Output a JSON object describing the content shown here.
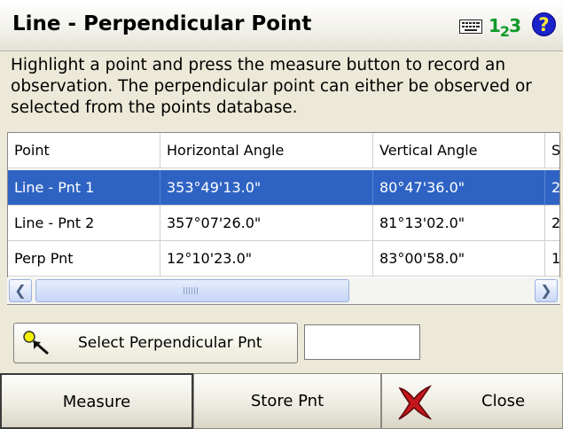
{
  "window": {
    "title": "Line - Perpendicular Point",
    "numeric_indicator": "1",
    "numeric_indicator_sub": "2",
    "numeric_indicator_tail": "3",
    "help_label": "?"
  },
  "instructions": "Highlight a point and press the measure button to record an observation. The perpendicular point can either be observed or selected from the points database.",
  "table": {
    "columns": [
      "Point",
      "Horizontal Angle",
      "Vertical Angle",
      "S"
    ],
    "rows": [
      {
        "point": "Line - Pnt 1",
        "horizontal_angle": "353°49'13.0\"",
        "vertical_angle": "80°47'36.0\"",
        "s": "2",
        "selected": true
      },
      {
        "point": "Line - Pnt 2",
        "horizontal_angle": "357°07'26.0\"",
        "vertical_angle": "81°13'02.0\"",
        "s": "2",
        "selected": false
      },
      {
        "point": "Perp Pnt",
        "horizontal_angle": "12°10'23.0\"",
        "vertical_angle": "83°00'58.0\"",
        "s": "1",
        "selected": false
      }
    ]
  },
  "select_button": {
    "label": "Select Perpendicular Pnt"
  },
  "perp_input": {
    "value": ""
  },
  "buttons": {
    "measure": "Measure",
    "store": "Store Pnt",
    "close": "Close"
  },
  "icons": {
    "keyboard": "keyboard-icon",
    "numeric": "numeric-mode-icon",
    "help": "help-icon",
    "select": "point-select-icon",
    "close": "red-x-icon"
  },
  "colors": {
    "selection": "#2f63c3",
    "help_bg": "#1b22c9",
    "numeric": "#0f9a28",
    "close_x": "#c4161c"
  }
}
